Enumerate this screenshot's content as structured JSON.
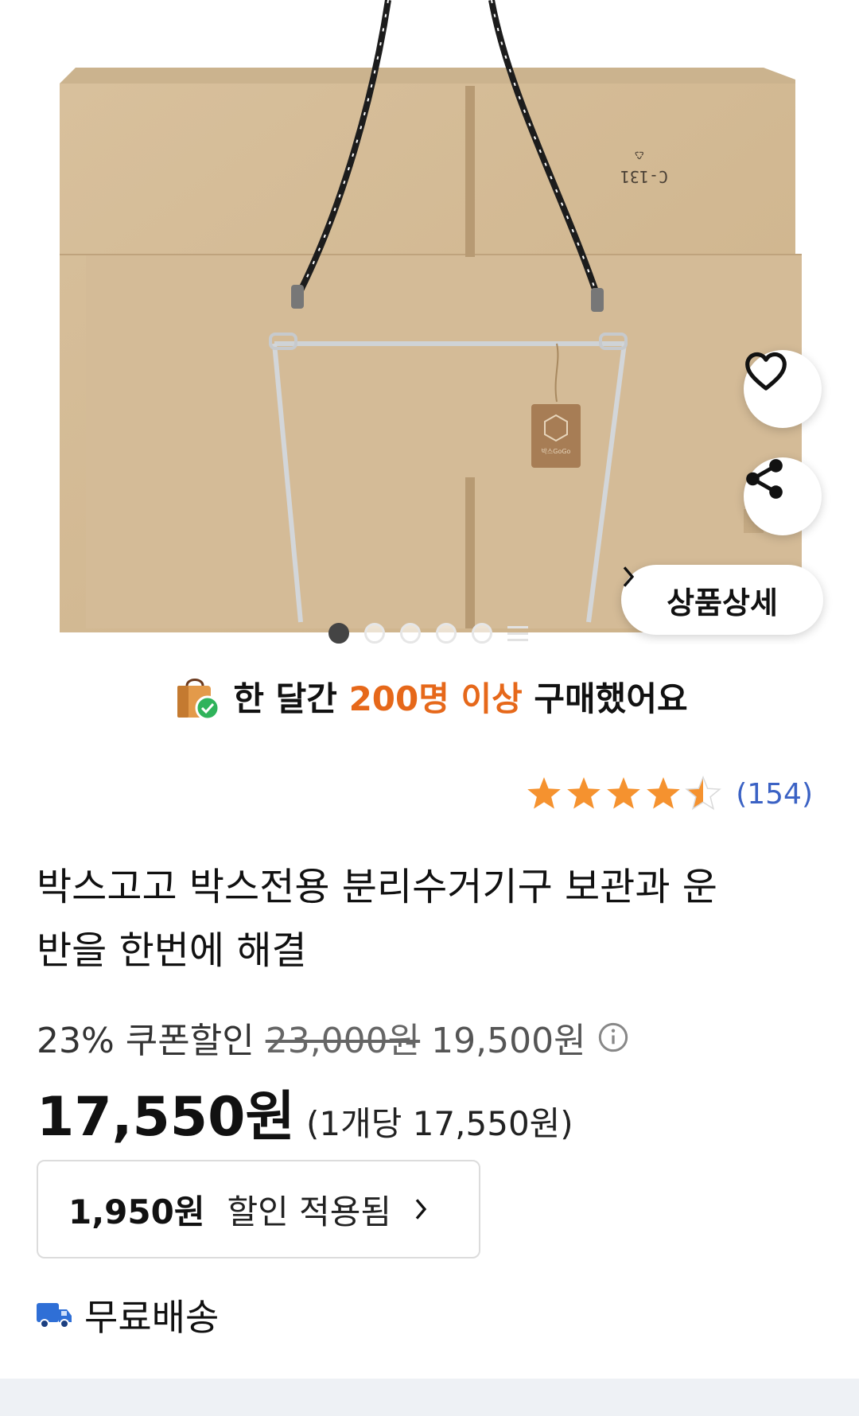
{
  "hero": {
    "box_print": "C-131",
    "tag_text": "박스GoGo"
  },
  "actions": {
    "wish_icon": "heart-outline-icon",
    "share_icon": "share-icon",
    "detail_label": "상품상세"
  },
  "gallery": {
    "total_dots": 5,
    "active_index": 0
  },
  "purchase_banner": {
    "prefix": "한 달간 ",
    "highlight": "200명 이상",
    "suffix": " 구매했어요",
    "highlight_color": "#e6681a"
  },
  "rating": {
    "score": 4.5,
    "count": "(154)",
    "star_color": "#f5922f"
  },
  "product": {
    "title": "박스고고 박스전용 분리수거기구 보관과 운반을 한번에 해결"
  },
  "price": {
    "coupon": "23% 쿠폰할인",
    "original": "23,000원",
    "sale": "19,500원",
    "final": "17,550원",
    "unit_price": "(1개당 17,550원)"
  },
  "discount": {
    "amount": "1,950원",
    "label": "할인 적용됨"
  },
  "shipping": {
    "label": "무료배송",
    "icon": "truck-icon"
  }
}
